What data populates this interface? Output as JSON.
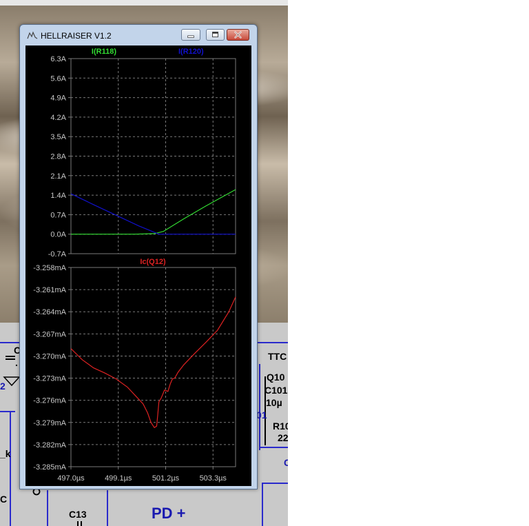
{
  "window": {
    "title": "HELLRAISER V1.2"
  },
  "schematic": {
    "labels": [
      "C",
      "2",
      "_k",
      "C",
      "C13",
      "PD +",
      "TTC",
      "Q10",
      "C101",
      "10µ",
      "R10",
      "22",
      "01",
      "C",
      "."
    ]
  },
  "colors": {
    "green_trace": "#33dd33",
    "blue_trace": "#1111cc",
    "red_trace": "#dd2222",
    "axis_text": "#c8c8c8",
    "grid": "#7a7a7a"
  },
  "chart_data": [
    {
      "type": "line",
      "legend": [
        "I(R118)",
        "I(R120)"
      ],
      "ylim": [
        -0.7,
        6.3
      ],
      "yticks": [
        "6.3A",
        "5.6A",
        "4.9A",
        "4.2A",
        "3.5A",
        "2.8A",
        "2.1A",
        "1.4A",
        "0.7A",
        "0.0A",
        "-0.7A"
      ],
      "ytick_values": [
        6.3,
        5.6,
        4.9,
        4.2,
        3.5,
        2.8,
        2.1,
        1.4,
        0.7,
        0.0,
        -0.7
      ],
      "xlim": [
        497.0,
        504.3
      ],
      "grid": true,
      "series": [
        {
          "name": "I(R118)",
          "color": "#33dd33",
          "x": [
            497.0,
            499.8,
            500.7,
            501.1,
            502.0,
            503.0,
            504.3
          ],
          "y": [
            0.0,
            0.0,
            0.02,
            0.1,
            0.55,
            1.02,
            1.6
          ]
        },
        {
          "name": "I(R120)",
          "color": "#1111cc",
          "x": [
            497.0,
            498.0,
            499.0,
            500.0,
            500.9,
            501.2,
            502.5,
            504.3
          ],
          "y": [
            1.45,
            1.06,
            0.68,
            0.3,
            0.0,
            0.0,
            0.0,
            0.0
          ]
        }
      ]
    },
    {
      "type": "line",
      "legend": [
        "Ic(Q12)"
      ],
      "ylim": [
        -3.285,
        -3.258
      ],
      "yticks": [
        "-3.258mA",
        "-3.261mA",
        "-3.264mA",
        "-3.267mA",
        "-3.270mA",
        "-3.273mA",
        "-3.276mA",
        "-3.279mA",
        "-3.282mA",
        "-3.285mA"
      ],
      "ytick_values": [
        -3.258,
        -3.261,
        -3.264,
        -3.267,
        -3.27,
        -3.273,
        -3.276,
        -3.279,
        -3.282,
        -3.285
      ],
      "xlim": [
        497.0,
        504.3
      ],
      "xticks": [
        "497.0µs",
        "499.1µs",
        "501.2µs",
        "503.3µs"
      ],
      "xtick_values": [
        497.0,
        499.1,
        501.2,
        503.3
      ],
      "grid": true,
      "series": [
        {
          "name": "Ic(Q12)",
          "color": "#dd2222",
          "x": [
            497.0,
            497.5,
            498.0,
            498.5,
            499.0,
            499.5,
            499.9,
            500.2,
            500.4,
            500.55,
            500.7,
            500.8,
            500.85,
            500.9,
            501.0,
            501.15,
            501.3,
            501.4,
            501.5,
            501.6,
            501.75,
            502.0,
            502.5,
            503.0,
            503.5,
            504.0,
            504.3
          ],
          "y": [
            -3.269,
            -3.2705,
            -3.2716,
            -3.2723,
            -3.2731,
            -3.2742,
            -3.2755,
            -3.2765,
            -3.2777,
            -3.279,
            -3.2797,
            -3.2795,
            -3.278,
            -3.2762,
            -3.2757,
            -3.2746,
            -3.2748,
            -3.2738,
            -3.2731,
            -3.273,
            -3.2722,
            -3.2712,
            -3.2696,
            -3.2681,
            -3.2665,
            -3.264,
            -3.262
          ]
        }
      ]
    }
  ]
}
